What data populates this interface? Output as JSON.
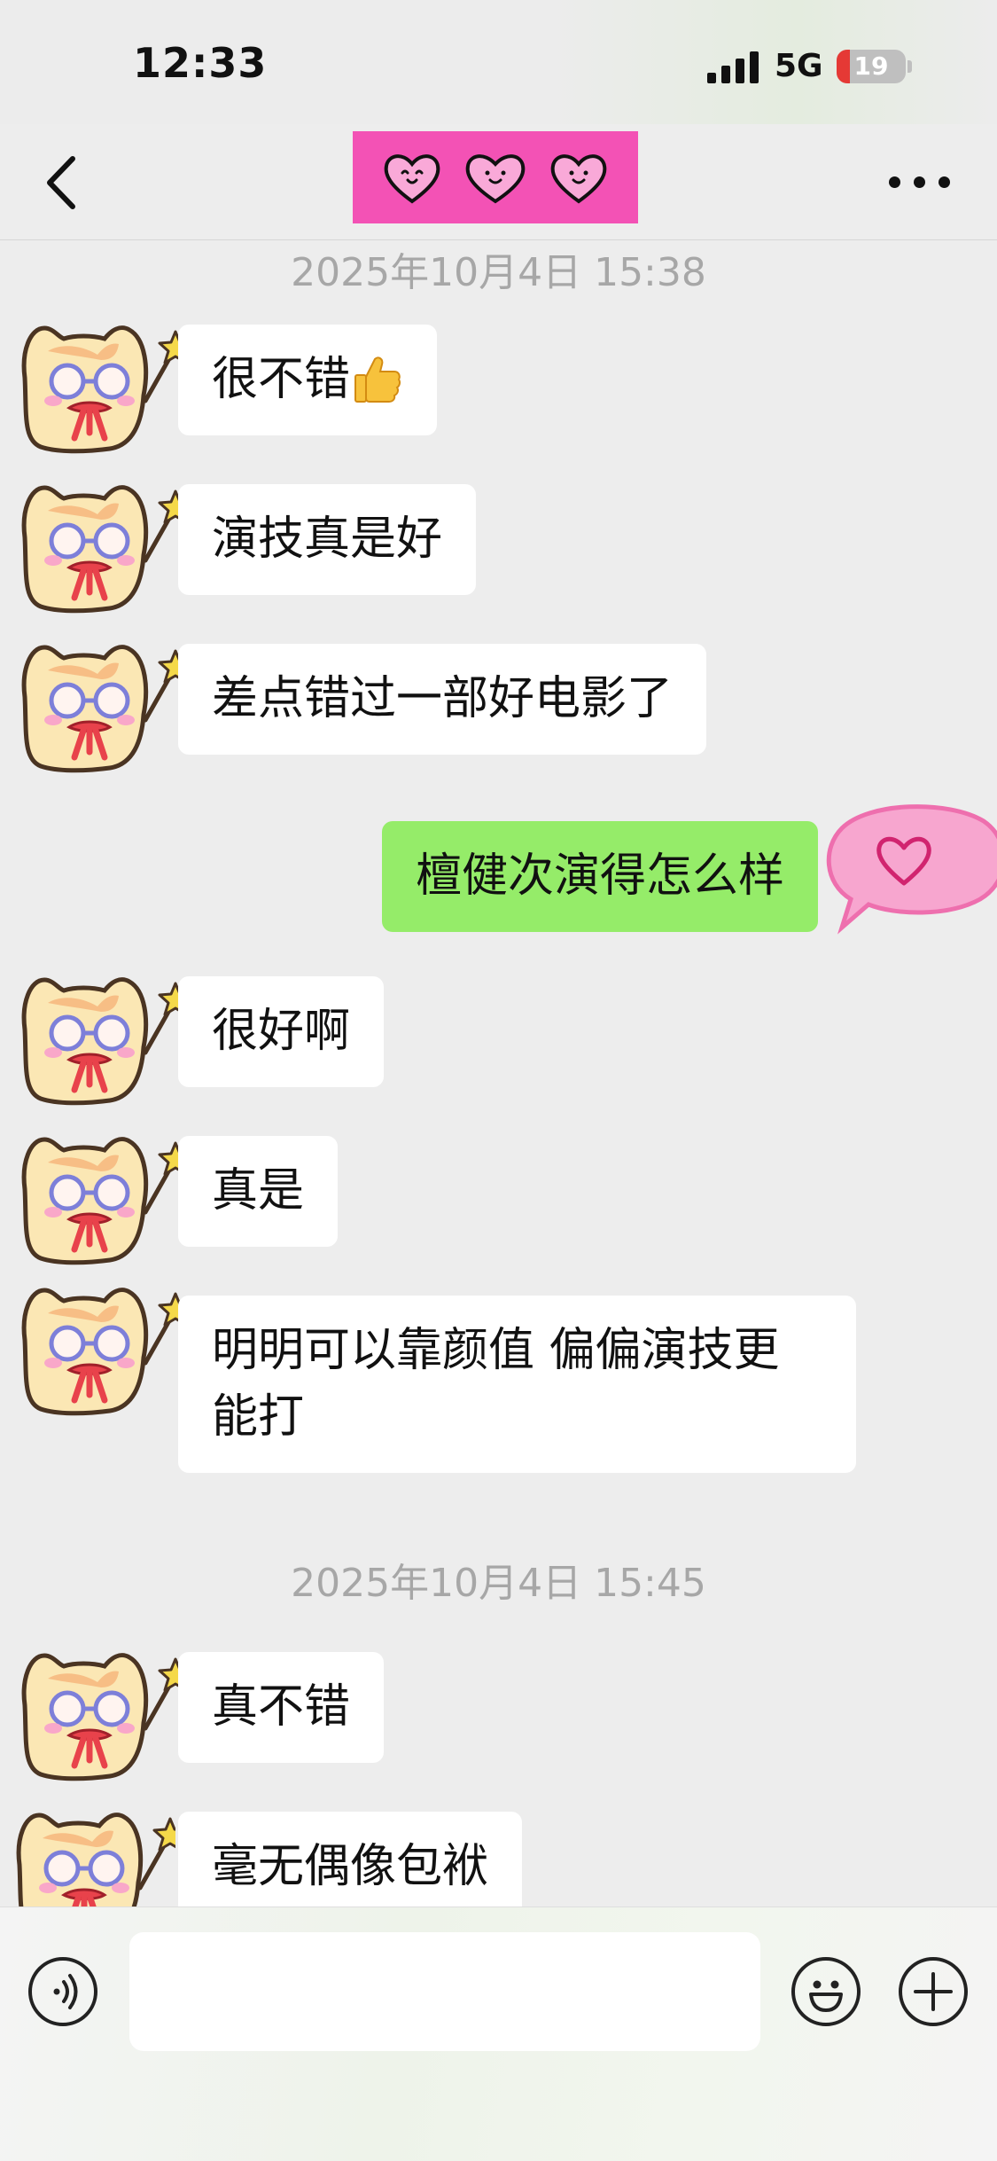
{
  "status_bar": {
    "time": "12:33",
    "network": "5G",
    "battery": "19",
    "battery_level_percent": 19
  },
  "navbar": {
    "back_icon": "chevron-left-icon",
    "title_icons": [
      "heart-face-icon",
      "heart-face-icon",
      "heart-face-icon"
    ],
    "title_bg": "#f352b5",
    "more_icon": "ellipsis-icon"
  },
  "chat": {
    "timestamp_1": "2025年10月4日 15:38",
    "timestamp_2": "2025年10月4日 15:45",
    "messages": [
      {
        "from": "other",
        "text": "很不错",
        "emoji": "thumbs-up-icon"
      },
      {
        "from": "other",
        "text": "演技真是好"
      },
      {
        "from": "other",
        "text": "差点错过一部好电影了"
      },
      {
        "from": "me",
        "text": "檀健次演得怎么样"
      },
      {
        "from": "other",
        "text": "很好啊"
      },
      {
        "from": "other",
        "text": "真是"
      },
      {
        "from": "other",
        "text": "明明可以靠颜值 偏偏演技更\n能打"
      },
      {
        "from": "other",
        "text": "真不错"
      },
      {
        "from": "other",
        "text": "毫无偶像包袱"
      }
    ]
  },
  "colors": {
    "my_bubble": "#95ec69",
    "other_bubble": "#ffffff",
    "chat_background": "#ededed",
    "timestamp": "#a7a7a7"
  },
  "input_bar": {
    "voice_icon": "voice-icon",
    "message_value": "",
    "emoji_icon": "smiley-icon",
    "plus_icon": "plus-icon"
  }
}
